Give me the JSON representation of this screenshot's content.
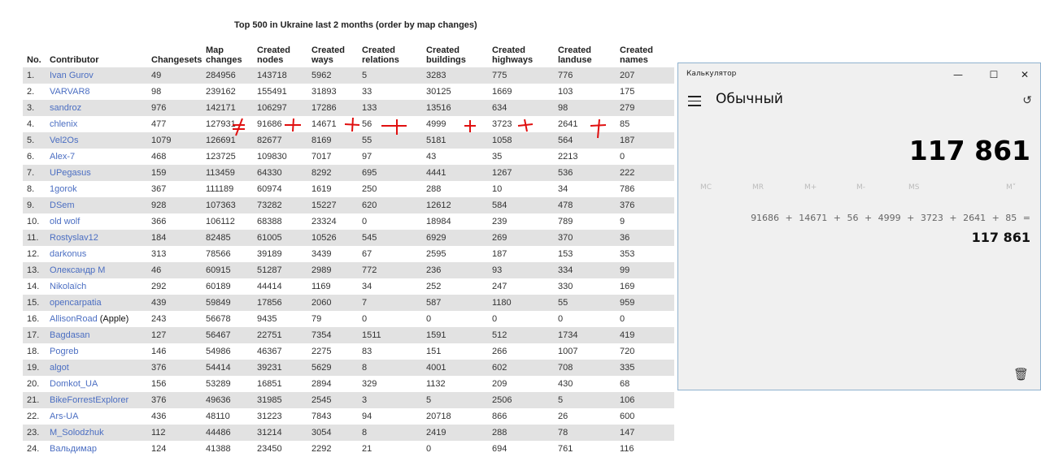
{
  "title": "Top 500 in Ukraine last 2 months (order by map changes)",
  "table": {
    "headers": [
      [
        "No.",
        ""
      ],
      [
        "Contributor",
        ""
      ],
      [
        "Changesets",
        ""
      ],
      [
        "Map",
        "changes"
      ],
      [
        "Created",
        "nodes"
      ],
      [
        "Created",
        "ways"
      ],
      [
        "Created",
        "relations"
      ],
      [
        "Created",
        "buildings"
      ],
      [
        "Created",
        "highways"
      ],
      [
        "Created",
        "landuse"
      ],
      [
        "Created",
        "names"
      ]
    ],
    "rows": [
      [
        "1.",
        "Ivan Gurov",
        "49",
        "284956",
        "143718",
        "5962",
        "5",
        "3283",
        "775",
        "776",
        "207"
      ],
      [
        "2.",
        "VARVAR8",
        "98",
        "239162",
        "155491",
        "31893",
        "33",
        "30125",
        "1669",
        "103",
        "175"
      ],
      [
        "3.",
        "sandroz",
        "976",
        "142171",
        "106297",
        "17286",
        "133",
        "13516",
        "634",
        "98",
        "279"
      ],
      [
        "4.",
        "chlenix",
        "477",
        "127931",
        "91686",
        "14671",
        "56",
        "4999",
        "3723",
        "2641",
        "85"
      ],
      [
        "5.",
        "Vel2Os",
        "1079",
        "126691",
        "82677",
        "8169",
        "55",
        "5181",
        "1058",
        "564",
        "187"
      ],
      [
        "6.",
        "Alex-7",
        "468",
        "123725",
        "109830",
        "7017",
        "97",
        "43",
        "35",
        "2213",
        "0"
      ],
      [
        "7.",
        "UPegasus",
        "159",
        "113459",
        "64330",
        "8292",
        "695",
        "4441",
        "1267",
        "536",
        "222"
      ],
      [
        "8.",
        "1gorok",
        "367",
        "111189",
        "60974",
        "1619",
        "250",
        "288",
        "10",
        "34",
        "786"
      ],
      [
        "9.",
        "DSem",
        "928",
        "107363",
        "73282",
        "15227",
        "620",
        "12612",
        "584",
        "478",
        "376"
      ],
      [
        "10.",
        "old wolf",
        "366",
        "106112",
        "68388",
        "23324",
        "0",
        "18984",
        "239",
        "789",
        "9"
      ],
      [
        "11.",
        "Rostyslav12",
        "184",
        "82485",
        "61005",
        "10526",
        "545",
        "6929",
        "269",
        "370",
        "36"
      ],
      [
        "12.",
        "darkonus",
        "313",
        "78566",
        "39189",
        "3439",
        "67",
        "2595",
        "187",
        "153",
        "353"
      ],
      [
        "13.",
        "Олександр М",
        "46",
        "60915",
        "51287",
        "2989",
        "772",
        "236",
        "93",
        "334",
        "99"
      ],
      [
        "14.",
        "Nikolaïch",
        "292",
        "60189",
        "44414",
        "1169",
        "34",
        "252",
        "247",
        "330",
        "169"
      ],
      [
        "15.",
        "opencarpatia",
        "439",
        "59849",
        "17856",
        "2060",
        "7",
        "587",
        "1180",
        "55",
        "959"
      ],
      [
        "16.",
        "AllisonRoad",
        "243",
        "56678",
        "9435",
        "79",
        "0",
        "0",
        "0",
        "0",
        "0"
      ],
      [
        "17.",
        "Bagdasan",
        "127",
        "56467",
        "22751",
        "7354",
        "1511",
        "1591",
        "512",
        "1734",
        "419"
      ],
      [
        "18.",
        "Pogreb",
        "146",
        "54986",
        "46367",
        "2275",
        "83",
        "151",
        "266",
        "1007",
        "720"
      ],
      [
        "19.",
        "algot",
        "376",
        "54414",
        "39231",
        "5629",
        "8",
        "4001",
        "602",
        "708",
        "335"
      ],
      [
        "20.",
        "Domkot_UA",
        "156",
        "53289",
        "16851",
        "2894",
        "329",
        "1132",
        "209",
        "430",
        "68"
      ],
      [
        "21.",
        "BikeForrestExplorer",
        "376",
        "49636",
        "31985",
        "2545",
        "3",
        "5",
        "2506",
        "5",
        "106"
      ],
      [
        "22.",
        "Ars-UA",
        "436",
        "48110",
        "31223",
        "7843",
        "94",
        "20718",
        "866",
        "26",
        "600"
      ],
      [
        "23.",
        "M_Solodzhuk",
        "112",
        "44486",
        "31214",
        "3054",
        "8",
        "2419",
        "288",
        "78",
        "147"
      ],
      [
        "24.",
        "Вальдимар",
        "124",
        "41388",
        "23450",
        "2292",
        "21",
        "0",
        "694",
        "761",
        "116"
      ]
    ],
    "row_notes": {
      "15": "(Apple)"
    }
  },
  "annotations": {
    "color": "#e01010",
    "symbols": [
      "≠",
      "+",
      "+",
      "+",
      "+",
      "+",
      "+",
      "+"
    ]
  },
  "calculator": {
    "window_title": "Калькулятор",
    "minimize": "—",
    "maximize": "☐",
    "close": "✕",
    "mode": "Обычный",
    "history_icon": "↺",
    "display": "117 861",
    "memory": [
      "MC",
      "MR",
      "M+",
      "M-",
      "MS",
      "M˅"
    ],
    "expression": "91686 + 14671 + 56 + 4999 + 3723 + 2641 + 85 =",
    "result": "117 861",
    "trash_icon": "🗑"
  }
}
